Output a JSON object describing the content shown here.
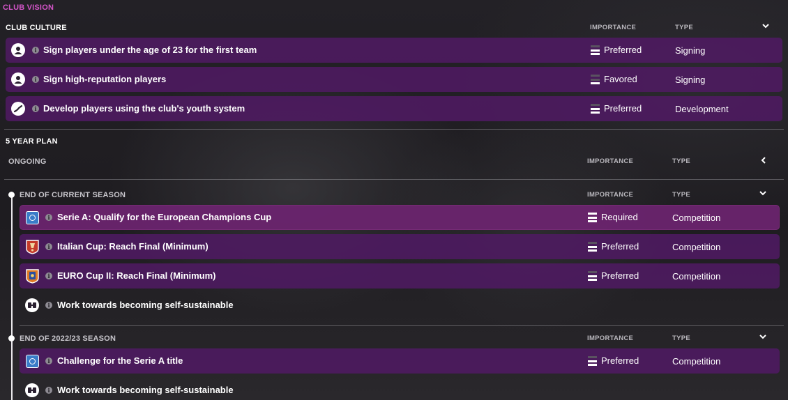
{
  "header": {
    "title": "CLUB VISION"
  },
  "club_culture": {
    "title": "CLUB CULTURE",
    "col_importance": "IMPORTANCE",
    "col_type": "TYPE",
    "rows": [
      {
        "label": "Sign players under the age of 23 for the first team",
        "importance": "Preferred",
        "type": "Signing",
        "icon": "person-icon"
      },
      {
        "label": "Sign high-reputation players",
        "importance": "Favored",
        "type": "Signing",
        "icon": "person-icon"
      },
      {
        "label": "Develop players using the club's youth system",
        "importance": "Preferred",
        "type": "Development",
        "icon": "growth-icon"
      }
    ]
  },
  "five_year_plan": {
    "title": "5 YEAR PLAN",
    "ongoing": {
      "title": "ONGOING",
      "col_importance": "IMPORTANCE",
      "col_type": "TYPE"
    },
    "groups": [
      {
        "title": "END OF CURRENT SEASON",
        "col_importance": "IMPORTANCE",
        "col_type": "TYPE",
        "rows": [
          {
            "label": "Serie A: Qualify for the European Champions Cup",
            "importance": "Required",
            "type": "Competition",
            "icon": "serie-a-badge-icon"
          },
          {
            "label": "Italian Cup: Reach Final (Minimum)",
            "importance": "Preferred",
            "type": "Competition",
            "icon": "italian-cup-badge-icon"
          },
          {
            "label": "EURO Cup II: Reach Final (Minimum)",
            "importance": "Preferred",
            "type": "Competition",
            "icon": "euro-cup-badge-icon"
          },
          {
            "label": "Work towards becoming self-sustainable",
            "importance": "",
            "type": "",
            "icon": "finance-icon"
          }
        ]
      },
      {
        "title": "END OF 2022/23 SEASON",
        "col_importance": "IMPORTANCE",
        "col_type": "TYPE",
        "rows": [
          {
            "label": "Challenge for the Serie A title",
            "importance": "Preferred",
            "type": "Competition",
            "icon": "serie-a-badge-icon"
          },
          {
            "label": "Work towards becoming self-sustainable",
            "importance": "",
            "type": "",
            "icon": "finance-icon"
          }
        ]
      }
    ]
  },
  "colors": {
    "accent": "#d455c9",
    "row_bg": "#4e1a62",
    "row_highlight": "#6c2470"
  }
}
